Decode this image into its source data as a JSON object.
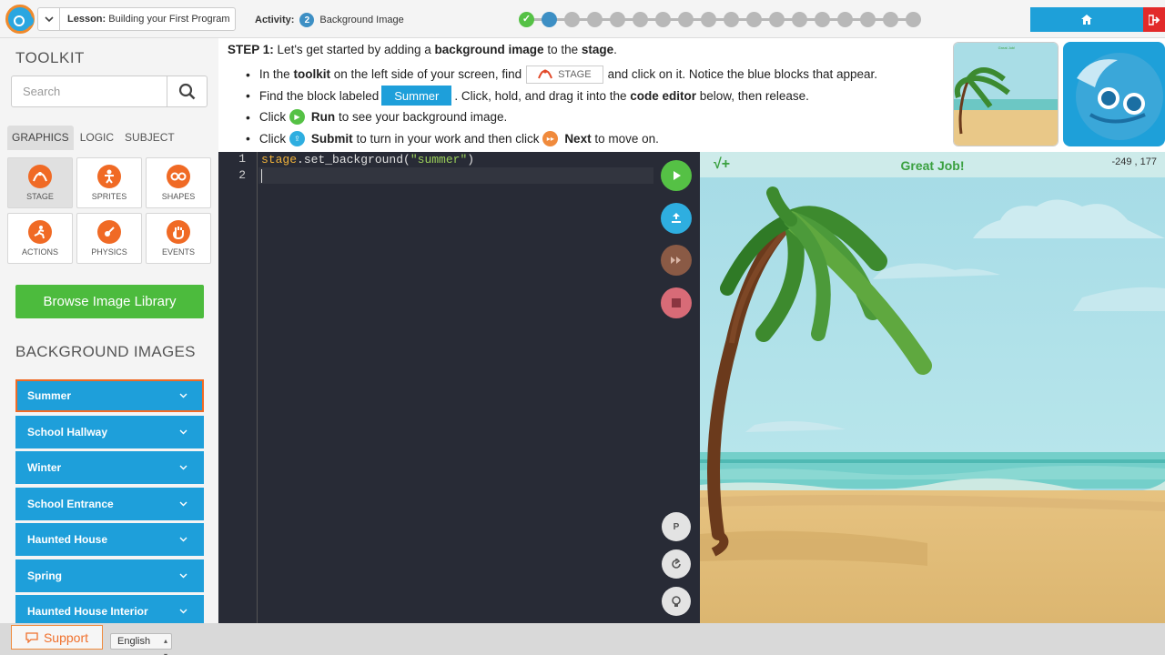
{
  "header": {
    "lesson_label": "Lesson:",
    "lesson_value": "Building your First Program",
    "activity_label": "Activity:",
    "activity_number": "2",
    "activity_name": "Background Image",
    "progress_total": 18,
    "progress_done": 1,
    "progress_current": 2
  },
  "toolkit": {
    "title": "TOOLKIT",
    "search_placeholder": "Search",
    "tabs": [
      "GRAPHICS",
      "LOGIC",
      "SUBJECT"
    ],
    "tiles": [
      "STAGE",
      "SPRITES",
      "SHAPES",
      "ACTIONS",
      "PHYSICS",
      "EVENTS"
    ],
    "browse_label": "Browse Image Library",
    "bg_title": "BACKGROUND IMAGES",
    "bg_items": [
      "Summer",
      "School Hallway",
      "Winter",
      "School Entrance",
      "Haunted House",
      "Spring",
      "Haunted House Interior"
    ]
  },
  "footer": {
    "support_label": "Support",
    "language": "English"
  },
  "instructions": {
    "step_label": "STEP 1:",
    "intro_a": "Let's get started by adding a",
    "intro_b": "background image",
    "intro_c": "to the",
    "intro_d": "stage",
    "intro_e": ".",
    "b1_a": "In the",
    "b1_b": "toolkit",
    "b1_c": "on the left side of your screen, find",
    "b1_chip": "STAGE",
    "b1_d": "and click on it. Notice the blue blocks that appear.",
    "b2_a": "Find the block labeled",
    "b2_chip": "Summer",
    "b2_b": ". Click, hold, and drag it into the",
    "b2_c": "code editor",
    "b2_d": "below, then release.",
    "b3_a": "Click",
    "b3_b": "Run",
    "b3_c": "to see your background image.",
    "b4_a": "Click",
    "b4_b": "Submit",
    "b4_c": "to turn in your work and then click",
    "b4_d": "Next",
    "b4_e": "to move on.",
    "thumb_caption": "Great Job!"
  },
  "editor": {
    "line_numbers": [
      "1",
      "2"
    ],
    "code_object": "stage",
    "code_method": ".set_background(",
    "code_string": "\"summer\"",
    "code_close": ")"
  },
  "stage": {
    "badge": "√+",
    "message": "Great Job!",
    "coords": "-249 , 177"
  },
  "colors": {
    "accent_blue": "#1e9fda",
    "brand_orange": "#f06a25",
    "success_green": "#4cbb3d",
    "editor_bg": "#282b36"
  },
  "icons": [
    "logo-icon",
    "chevron-down-icon",
    "home-icon",
    "exit-icon",
    "search-icon",
    "stage-icon",
    "sprites-icon",
    "shapes-icon",
    "actions-icon",
    "physics-icon",
    "events-icon",
    "support-icon",
    "run-icon",
    "submit-icon",
    "next-icon",
    "stop-icon",
    "p-icon",
    "reset-icon",
    "hint-icon"
  ]
}
